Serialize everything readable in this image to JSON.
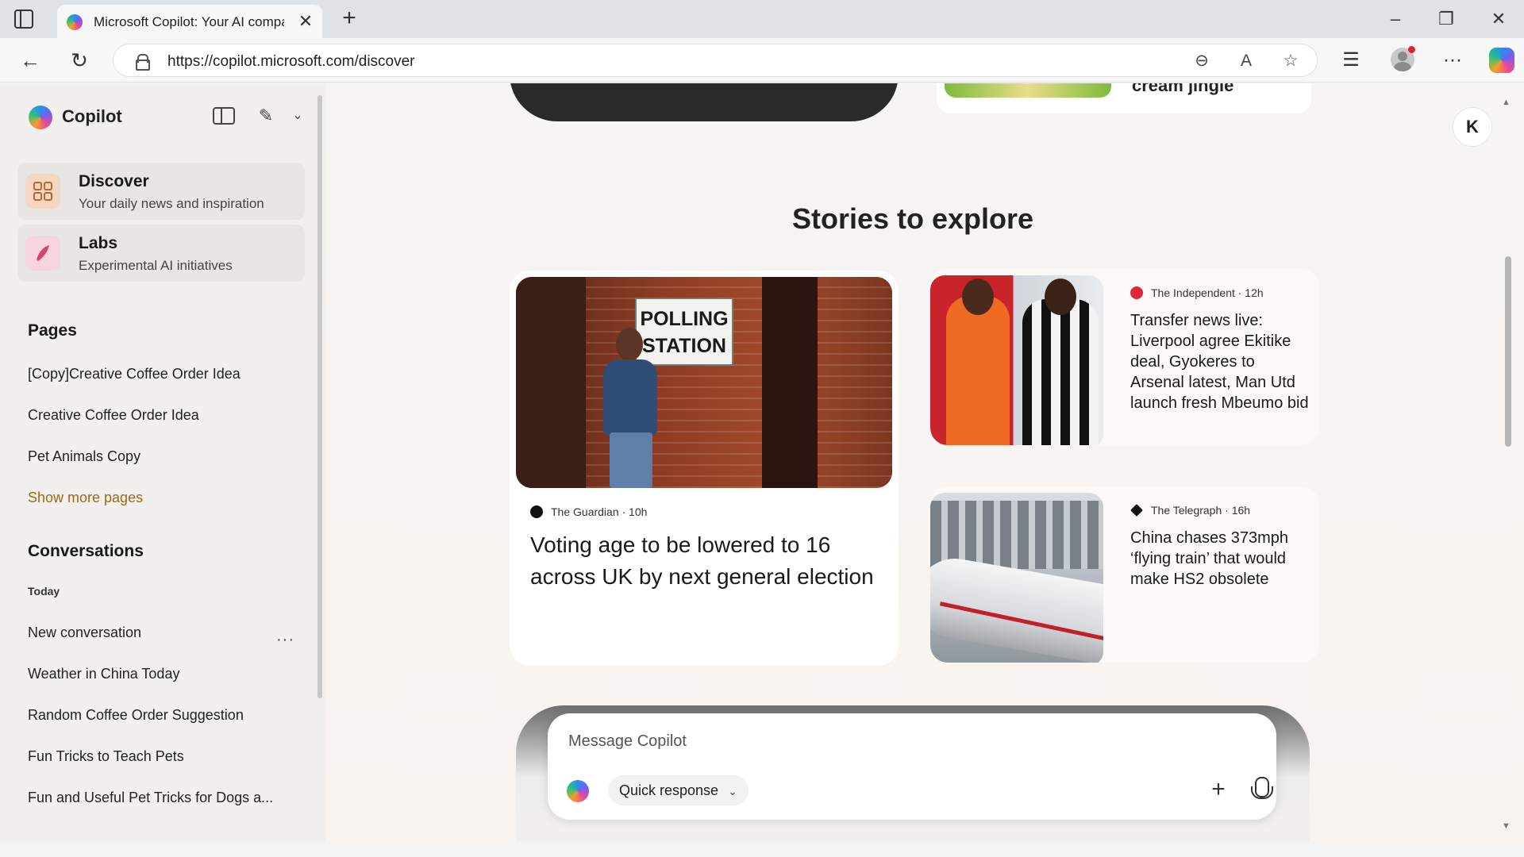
{
  "browser": {
    "tab_title": "Microsoft Copilot: Your AI compa",
    "url": "https://copilot.microsoft.com/discover",
    "tab_close": "✕",
    "new_tab": "+",
    "minimize": "–",
    "restore": "❐",
    "close": "✕"
  },
  "sidebar": {
    "brand": "Copilot",
    "nav": [
      {
        "title": "Discover",
        "subtitle": "Your daily news and inspiration"
      },
      {
        "title": "Labs",
        "subtitle": "Experimental AI initiatives"
      }
    ],
    "pages_heading": "Pages",
    "pages": [
      "[Copy]Creative Coffee Order Idea",
      "Creative Coffee Order Idea",
      "Pet Animals Copy"
    ],
    "show_more": "Show more pages",
    "conversations_heading": "Conversations",
    "today_label": "Today",
    "conversations": [
      "New conversation",
      "Weather in China Today",
      "Random Coffee Order Suggestion",
      "Fun Tricks to Teach Pets",
      "Fun and Useful Pet Tricks for Dogs a..."
    ],
    "more_label": "···"
  },
  "main": {
    "top_partial_title": "cream jingle",
    "avatar_letter": "K",
    "section_title": "Stories to explore",
    "stories": [
      {
        "source": "The Guardian · 10h",
        "headline": "Voting age to be lowered to 16 across UK by next general election",
        "image_sign": "POLLING STATION"
      },
      {
        "source": "The Independent · 12h",
        "headline": "Transfer news live: Liverpool agree Ekitike deal, Gyokeres to Arsenal latest, Man Utd launch fresh Mbeumo bid"
      },
      {
        "source": "The Telegraph · 16h",
        "headline": "China chases 373mph ‘flying train’ that would make HS2 obsolete"
      }
    ],
    "composer": {
      "placeholder": "Message Copilot",
      "mode": "Quick response",
      "plus": "+"
    }
  },
  "colors": {
    "accent_link": "#9a6a1a",
    "independent_red": "#e0263a",
    "sidebar_bg": "#f1f0ee"
  }
}
